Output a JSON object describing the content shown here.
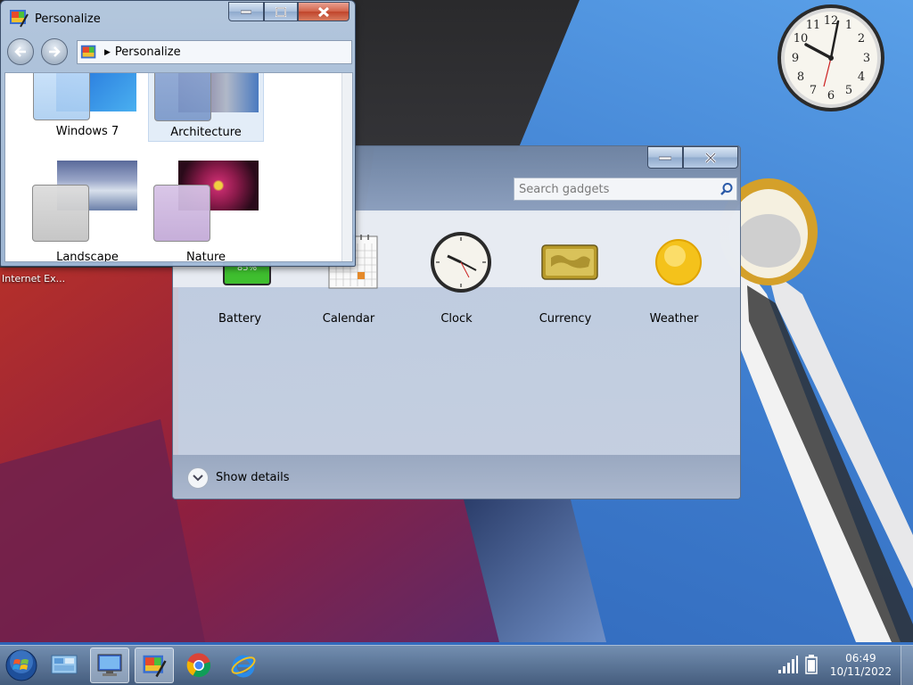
{
  "desktop": {
    "icon_label": "Internet Ex..."
  },
  "clock_gadget": {
    "numbers": [
      "12",
      "1",
      "2",
      "3",
      "4",
      "5",
      "6",
      "7",
      "8",
      "9",
      "10",
      "11"
    ]
  },
  "personalize_window": {
    "title": "Personalize",
    "address": "Personalize",
    "themes": [
      {
        "label": "Windows 7"
      },
      {
        "label": "Architecture",
        "selected": true
      },
      {
        "label": "Landscape"
      },
      {
        "label": "Nature"
      }
    ]
  },
  "gadget_gallery": {
    "search_placeholder": "Search gadgets",
    "battery_text": "85%",
    "gadgets": [
      {
        "label": "Battery"
      },
      {
        "label": "Calendar"
      },
      {
        "label": "Clock"
      },
      {
        "label": "Currency"
      },
      {
        "label": "Weather"
      }
    ],
    "show_details": "Show details"
  },
  "taskbar": {
    "time": "06:49",
    "date": "10/11/2022"
  },
  "colors": {
    "accent": "#2d62b5",
    "close_red": "#c0432a"
  }
}
